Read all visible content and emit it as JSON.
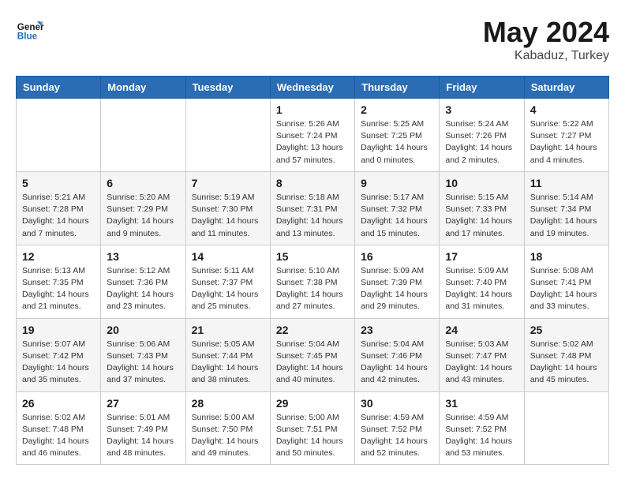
{
  "logo": {
    "line1": "General",
    "line2": "Blue"
  },
  "title": "May 2024",
  "subtitle": "Kabaduz, Turkey",
  "weekdays": [
    "Sunday",
    "Monday",
    "Tuesday",
    "Wednesday",
    "Thursday",
    "Friday",
    "Saturday"
  ],
  "weeks": [
    [
      {
        "day": "",
        "sunrise": "",
        "sunset": "",
        "daylight": ""
      },
      {
        "day": "",
        "sunrise": "",
        "sunset": "",
        "daylight": ""
      },
      {
        "day": "",
        "sunrise": "",
        "sunset": "",
        "daylight": ""
      },
      {
        "day": "1",
        "sunrise": "Sunrise: 5:26 AM",
        "sunset": "Sunset: 7:24 PM",
        "daylight": "Daylight: 13 hours and 57 minutes."
      },
      {
        "day": "2",
        "sunrise": "Sunrise: 5:25 AM",
        "sunset": "Sunset: 7:25 PM",
        "daylight": "Daylight: 14 hours and 0 minutes."
      },
      {
        "day": "3",
        "sunrise": "Sunrise: 5:24 AM",
        "sunset": "Sunset: 7:26 PM",
        "daylight": "Daylight: 14 hours and 2 minutes."
      },
      {
        "day": "4",
        "sunrise": "Sunrise: 5:22 AM",
        "sunset": "Sunset: 7:27 PM",
        "daylight": "Daylight: 14 hours and 4 minutes."
      }
    ],
    [
      {
        "day": "5",
        "sunrise": "Sunrise: 5:21 AM",
        "sunset": "Sunset: 7:28 PM",
        "daylight": "Daylight: 14 hours and 7 minutes."
      },
      {
        "day": "6",
        "sunrise": "Sunrise: 5:20 AM",
        "sunset": "Sunset: 7:29 PM",
        "daylight": "Daylight: 14 hours and 9 minutes."
      },
      {
        "day": "7",
        "sunrise": "Sunrise: 5:19 AM",
        "sunset": "Sunset: 7:30 PM",
        "daylight": "Daylight: 14 hours and 11 minutes."
      },
      {
        "day": "8",
        "sunrise": "Sunrise: 5:18 AM",
        "sunset": "Sunset: 7:31 PM",
        "daylight": "Daylight: 14 hours and 13 minutes."
      },
      {
        "day": "9",
        "sunrise": "Sunrise: 5:17 AM",
        "sunset": "Sunset: 7:32 PM",
        "daylight": "Daylight: 14 hours and 15 minutes."
      },
      {
        "day": "10",
        "sunrise": "Sunrise: 5:15 AM",
        "sunset": "Sunset: 7:33 PM",
        "daylight": "Daylight: 14 hours and 17 minutes."
      },
      {
        "day": "11",
        "sunrise": "Sunrise: 5:14 AM",
        "sunset": "Sunset: 7:34 PM",
        "daylight": "Daylight: 14 hours and 19 minutes."
      }
    ],
    [
      {
        "day": "12",
        "sunrise": "Sunrise: 5:13 AM",
        "sunset": "Sunset: 7:35 PM",
        "daylight": "Daylight: 14 hours and 21 minutes."
      },
      {
        "day": "13",
        "sunrise": "Sunrise: 5:12 AM",
        "sunset": "Sunset: 7:36 PM",
        "daylight": "Daylight: 14 hours and 23 minutes."
      },
      {
        "day": "14",
        "sunrise": "Sunrise: 5:11 AM",
        "sunset": "Sunset: 7:37 PM",
        "daylight": "Daylight: 14 hours and 25 minutes."
      },
      {
        "day": "15",
        "sunrise": "Sunrise: 5:10 AM",
        "sunset": "Sunset: 7:38 PM",
        "daylight": "Daylight: 14 hours and 27 minutes."
      },
      {
        "day": "16",
        "sunrise": "Sunrise: 5:09 AM",
        "sunset": "Sunset: 7:39 PM",
        "daylight": "Daylight: 14 hours and 29 minutes."
      },
      {
        "day": "17",
        "sunrise": "Sunrise: 5:09 AM",
        "sunset": "Sunset: 7:40 PM",
        "daylight": "Daylight: 14 hours and 31 minutes."
      },
      {
        "day": "18",
        "sunrise": "Sunrise: 5:08 AM",
        "sunset": "Sunset: 7:41 PM",
        "daylight": "Daylight: 14 hours and 33 minutes."
      }
    ],
    [
      {
        "day": "19",
        "sunrise": "Sunrise: 5:07 AM",
        "sunset": "Sunset: 7:42 PM",
        "daylight": "Daylight: 14 hours and 35 minutes."
      },
      {
        "day": "20",
        "sunrise": "Sunrise: 5:06 AM",
        "sunset": "Sunset: 7:43 PM",
        "daylight": "Daylight: 14 hours and 37 minutes."
      },
      {
        "day": "21",
        "sunrise": "Sunrise: 5:05 AM",
        "sunset": "Sunset: 7:44 PM",
        "daylight": "Daylight: 14 hours and 38 minutes."
      },
      {
        "day": "22",
        "sunrise": "Sunrise: 5:04 AM",
        "sunset": "Sunset: 7:45 PM",
        "daylight": "Daylight: 14 hours and 40 minutes."
      },
      {
        "day": "23",
        "sunrise": "Sunrise: 5:04 AM",
        "sunset": "Sunset: 7:46 PM",
        "daylight": "Daylight: 14 hours and 42 minutes."
      },
      {
        "day": "24",
        "sunrise": "Sunrise: 5:03 AM",
        "sunset": "Sunset: 7:47 PM",
        "daylight": "Daylight: 14 hours and 43 minutes."
      },
      {
        "day": "25",
        "sunrise": "Sunrise: 5:02 AM",
        "sunset": "Sunset: 7:48 PM",
        "daylight": "Daylight: 14 hours and 45 minutes."
      }
    ],
    [
      {
        "day": "26",
        "sunrise": "Sunrise: 5:02 AM",
        "sunset": "Sunset: 7:48 PM",
        "daylight": "Daylight: 14 hours and 46 minutes."
      },
      {
        "day": "27",
        "sunrise": "Sunrise: 5:01 AM",
        "sunset": "Sunset: 7:49 PM",
        "daylight": "Daylight: 14 hours and 48 minutes."
      },
      {
        "day": "28",
        "sunrise": "Sunrise: 5:00 AM",
        "sunset": "Sunset: 7:50 PM",
        "daylight": "Daylight: 14 hours and 49 minutes."
      },
      {
        "day": "29",
        "sunrise": "Sunrise: 5:00 AM",
        "sunset": "Sunset: 7:51 PM",
        "daylight": "Daylight: 14 hours and 50 minutes."
      },
      {
        "day": "30",
        "sunrise": "Sunrise: 4:59 AM",
        "sunset": "Sunset: 7:52 PM",
        "daylight": "Daylight: 14 hours and 52 minutes."
      },
      {
        "day": "31",
        "sunrise": "Sunrise: 4:59 AM",
        "sunset": "Sunset: 7:52 PM",
        "daylight": "Daylight: 14 hours and 53 minutes."
      },
      {
        "day": "",
        "sunrise": "",
        "sunset": "",
        "daylight": ""
      }
    ]
  ]
}
